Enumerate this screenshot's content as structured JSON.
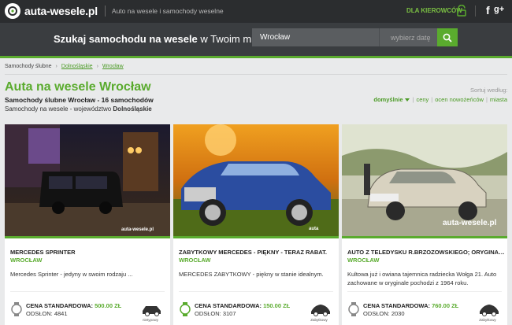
{
  "header": {
    "logo": "auta-wesele.pl",
    "tagline": "Auto na wesele i samochody weselne",
    "drivers_link": "DLA KIEROWCÓW",
    "facebook": "f",
    "google": "g+"
  },
  "search": {
    "label_bold": "Szukaj samochodu na wesele",
    "label_rest": " w Twoim mieście:",
    "city_value": "Wrocław",
    "date_placeholder": "wybierz datę"
  },
  "breadcrumb": [
    "Samochody ślubne",
    "Dolnośląskie",
    "Wrocław"
  ],
  "page": {
    "title": "Auta na wesele Wrocław",
    "subtitle": "Samochody ślubne Wrocław - 16 samochodów",
    "subtitle2_prefix": "Samochody na wesele - województwo ",
    "subtitle2_region": "Dolnośląskie"
  },
  "sort": {
    "label": "Sortuj według:",
    "active": "domyślnie",
    "options": [
      "ceny",
      "ocen nowożeńców",
      "miasta"
    ]
  },
  "cards": [
    {
      "title": "MERCEDES SPRINTER",
      "city": "WROCŁAW",
      "desc": "Mercedes Sprinter - jedyny w swoim rodzaju ...",
      "price_label": "CENA STANDARDOWA: ",
      "price_value": "500.00 ZŁ",
      "views": "ODSŁON: 4841",
      "type": "nietypowy",
      "watermark": "auta-wesele.pl"
    },
    {
      "title": "ZABYTKOWY MERCEDES - PIĘKNY - TERAZ RABAT.",
      "city": "WROCŁAW",
      "desc": "MERCEDES ZABYTKOWY - piękny w stanie idealnym.",
      "price_label": "CENA STANDARDOWA: ",
      "price_value": "150.00 ZŁ",
      "views": "ODSŁON: 3107",
      "type": "Zabytkowy",
      "watermark": "auta"
    },
    {
      "title": "AUTO Z TELEDYSKU R.BRZOZOWSKIEGO; ORYGINAL...",
      "city": "WROCŁAW",
      "desc": "Kultowa już i owiana tajemnica radziecka Wołga 21. Auto zachowane w oryginale pochodzi z 1964 roku.",
      "price_label": "CENA STANDARDOWA: ",
      "price_value": "760.00 ZŁ",
      "views": "ODSŁON: 2030",
      "type": "Zabytkowy",
      "watermark": "auta-wesele.pl"
    }
  ],
  "colors": {
    "brand": "#5aab2e",
    "topbar": "#2b2d2f",
    "searchbar": "#3a3d40"
  }
}
